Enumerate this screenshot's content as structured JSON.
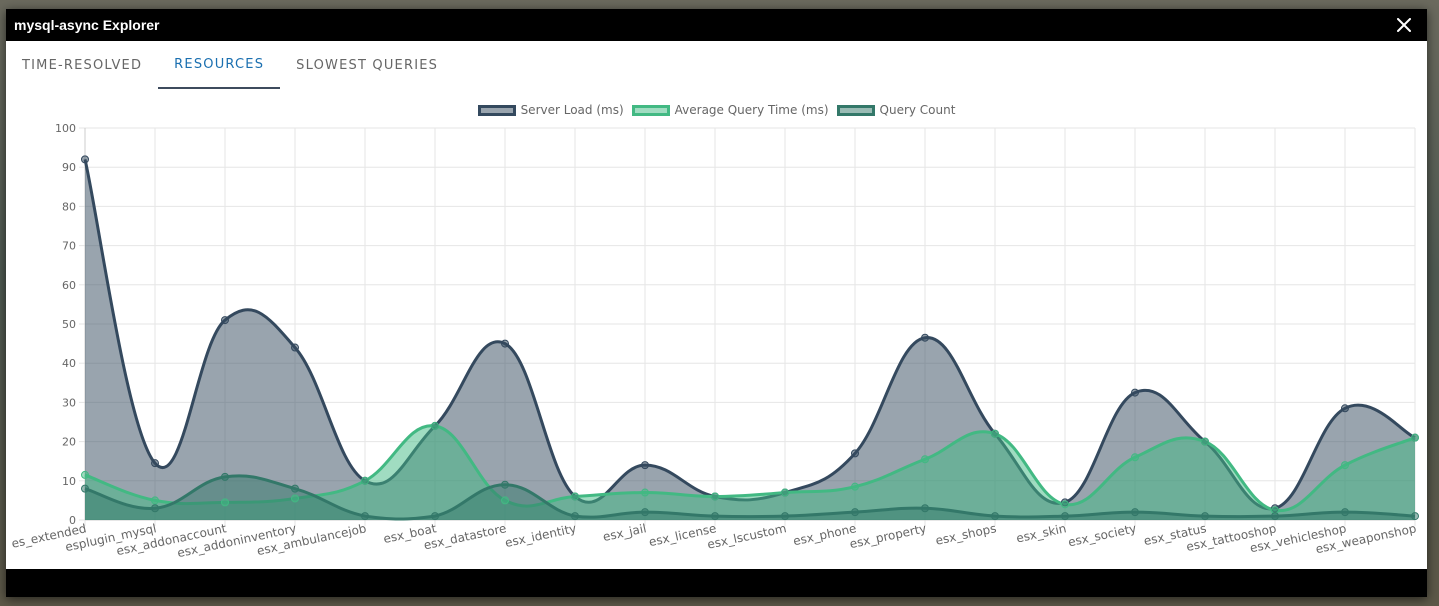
{
  "window": {
    "title": "mysql-async Explorer"
  },
  "tabs": [
    {
      "label": "Time-Resolved",
      "active": false
    },
    {
      "label": "Resources",
      "active": true
    },
    {
      "label": "Slowest Queries",
      "active": false
    }
  ],
  "icons": {
    "close": "close-icon"
  },
  "chart_data": {
    "type": "area",
    "title": "",
    "xlabel": "",
    "ylabel": "",
    "ylim": [
      0,
      100
    ],
    "yticks": [
      0,
      10,
      20,
      30,
      40,
      50,
      60,
      70,
      80,
      90,
      100
    ],
    "grid": true,
    "legend_position": "top-center",
    "categories": [
      "es_extended",
      "esplugin_mysql",
      "esx_addonaccount",
      "esx_addoninventory",
      "esx_ambulancejob",
      "esx_boat",
      "esx_datastore",
      "esx_identity",
      "esx_jail",
      "esx_license",
      "esx_lscustom",
      "esx_phone",
      "esx_property",
      "esx_shops",
      "esx_skin",
      "esx_society",
      "esx_status",
      "esx_tattooshop",
      "esx_vehicleshop",
      "esx_weaponshop"
    ],
    "series": [
      {
        "name": "Server Load (ms)",
        "color": "#34495e",
        "fill": "rgba(52,73,94,0.5)",
        "values": [
          92,
          14.5,
          51,
          44,
          10,
          24,
          45,
          6,
          14,
          6,
          7,
          17,
          46.5,
          22,
          4.5,
          32.5,
          20,
          3,
          28.5,
          21
        ]
      },
      {
        "name": "Average Query Time (ms)",
        "color": "#42b983",
        "fill": "rgba(66,185,131,0.5)",
        "values": [
          11.5,
          5,
          4.5,
          5.5,
          10,
          24,
          5,
          6,
          7,
          6,
          7,
          8.5,
          15.5,
          22,
          4,
          16,
          20,
          2.5,
          14,
          21
        ]
      },
      {
        "name": "Query Count",
        "color": "#337869",
        "fill": "rgba(51,120,105,0.5)",
        "values": [
          8,
          3,
          11,
          8,
          1,
          1,
          9,
          1,
          2,
          1,
          1,
          2,
          3,
          1,
          1,
          2,
          1,
          1,
          2,
          1
        ]
      }
    ]
  }
}
